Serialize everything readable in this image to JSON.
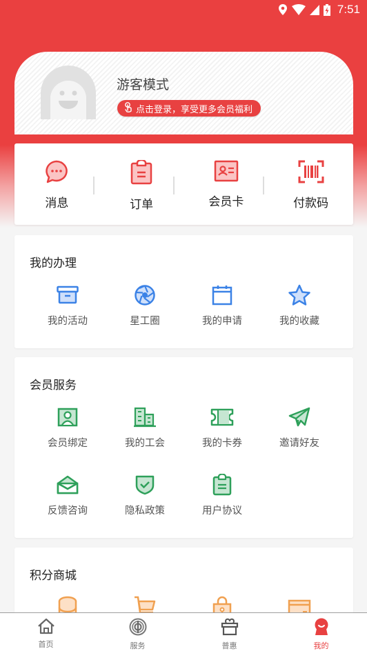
{
  "status_bar": {
    "time": "7:51",
    "icons": [
      "location-icon",
      "wifi-icon",
      "signal-icon",
      "battery-charging-icon"
    ]
  },
  "colors": {
    "brand_red": "#e84141",
    "blue_icons": "#3b82e6",
    "green_icons": "#2ea05a",
    "orange_icons": "#f0a050"
  },
  "profile": {
    "name": "游客模式",
    "login_prompt": "点击登录，享受更多会员福利",
    "login_icon": "tap-finger-icon",
    "avatar_icon": "default-avatar-icon"
  },
  "quick_actions": [
    {
      "label": "消息",
      "icon": "message-icon"
    },
    {
      "label": "订单",
      "icon": "clipboard-icon"
    },
    {
      "label": "会员卡",
      "icon": "member-card-icon"
    },
    {
      "label": "付款码",
      "icon": "barcode-icon"
    }
  ],
  "sections": {
    "my_handling": {
      "title": "我的办理",
      "items": [
        {
          "label": "我的活动",
          "icon": "box-icon"
        },
        {
          "label": "星工圈",
          "icon": "aperture-icon"
        },
        {
          "label": "我的申请",
          "icon": "calendar-icon"
        },
        {
          "label": "我的收藏",
          "icon": "star-icon"
        }
      ]
    },
    "member_services": {
      "title": "会员服务",
      "items": [
        {
          "label": "会员绑定",
          "icon": "user-portrait-icon"
        },
        {
          "label": "我的工会",
          "icon": "building-icon"
        },
        {
          "label": "我的卡券",
          "icon": "ticket-icon"
        },
        {
          "label": "邀请好友",
          "icon": "paper-plane-icon"
        },
        {
          "label": "反馈咨询",
          "icon": "open-envelope-icon"
        },
        {
          "label": "隐私政策",
          "icon": "shield-check-icon"
        },
        {
          "label": "用户协议",
          "icon": "clipboard-icon"
        }
      ]
    },
    "points_mall": {
      "title": "积分商城",
      "items": [
        {
          "icon": "coins-icon"
        },
        {
          "icon": "cart-icon"
        },
        {
          "icon": "lock-bag-icon"
        },
        {
          "icon": "wallet-card-icon"
        }
      ]
    }
  },
  "tabbar": {
    "tabs": [
      {
        "label": "首页",
        "icon": "home-icon",
        "active": false
      },
      {
        "label": "服务",
        "icon": "union-emblem-icon",
        "active": false
      },
      {
        "label": "普惠",
        "icon": "gift-icon",
        "active": false
      },
      {
        "label": "我的",
        "icon": "profile-mascot-icon",
        "active": true
      }
    ]
  }
}
